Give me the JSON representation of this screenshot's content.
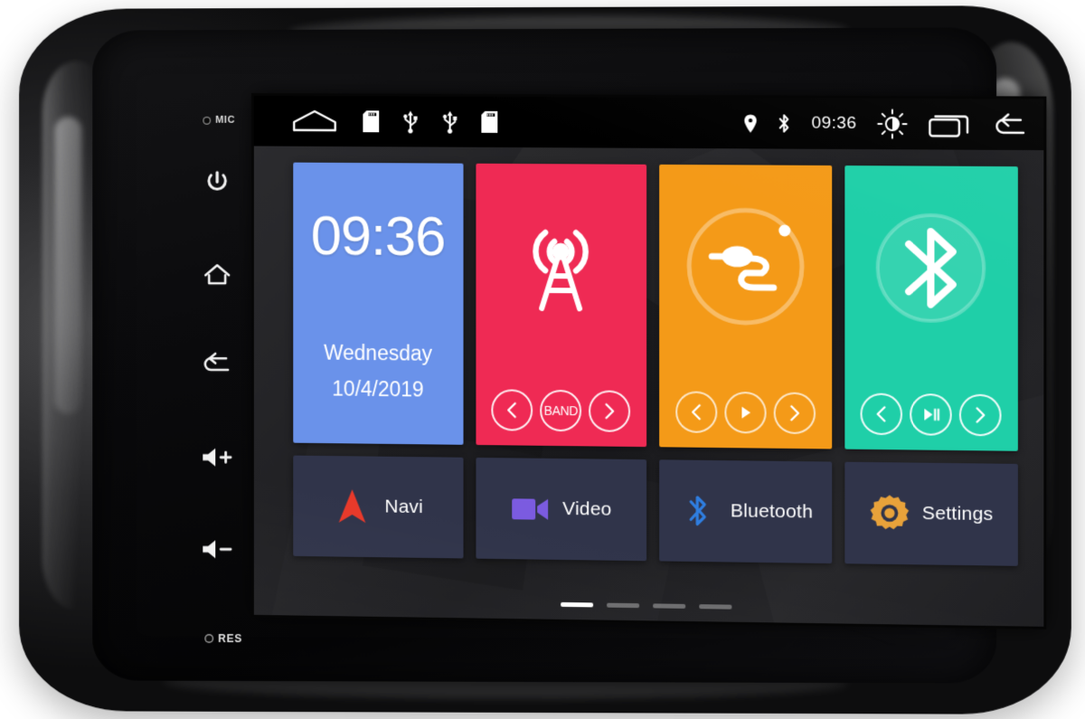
{
  "device": {
    "bezel": {
      "mic_label": "MIC",
      "res_label": "RES",
      "buttons": [
        {
          "name": "power",
          "label": ""
        },
        {
          "name": "home",
          "label": ""
        },
        {
          "name": "back",
          "label": ""
        },
        {
          "name": "volume-up",
          "label": ""
        },
        {
          "name": "volume-down",
          "label": ""
        }
      ]
    }
  },
  "statusbar": {
    "left_icons": [
      "home-icon",
      "sd-card-icon",
      "usb-icon",
      "usb-icon",
      "sd-card-icon"
    ],
    "right_icons": [
      "location-pin-icon",
      "bluetooth-icon",
      "brightness-icon",
      "recents-icon",
      "back-icon"
    ],
    "time": "09:36"
  },
  "tiles": [
    {
      "name": "clock-widget",
      "color": "#6a92ea",
      "time": "09:36",
      "day": "Wednesday",
      "date": "10/4/2019"
    },
    {
      "name": "radio-widget",
      "color": "#ef2a54",
      "art_icon": "radio-tower-icon",
      "controls": [
        {
          "name": "radio-prev-button",
          "icon": "chevron-left-icon",
          "label": ""
        },
        {
          "name": "radio-band-button",
          "icon": "band-text",
          "label": "BAND"
        },
        {
          "name": "radio-next-button",
          "icon": "chevron-right-icon",
          "label": ""
        }
      ]
    },
    {
      "name": "aux-widget",
      "color": "#f49a18",
      "art_icon": "aux-cable-icon",
      "controls": [
        {
          "name": "aux-prev-button",
          "icon": "chevron-left-icon",
          "label": ""
        },
        {
          "name": "aux-play-button",
          "icon": "play-icon",
          "label": ""
        },
        {
          "name": "aux-next-button",
          "icon": "chevron-right-icon",
          "label": ""
        }
      ]
    },
    {
      "name": "bluetooth-widget",
      "color": "#1fcfa8",
      "art_icon": "bluetooth-icon",
      "controls": [
        {
          "name": "bt-prev-button",
          "icon": "chevron-left-icon",
          "label": ""
        },
        {
          "name": "bt-playpause-button",
          "icon": "play-pause-icon",
          "label": ""
        },
        {
          "name": "bt-next-button",
          "icon": "chevron-right-icon",
          "label": ""
        }
      ]
    }
  ],
  "shortcuts": [
    {
      "name": "navi",
      "label": "Navi",
      "icon": "navigation-arrow-icon",
      "color": "#e8392a"
    },
    {
      "name": "video",
      "label": "Video",
      "icon": "video-camera-icon",
      "color": "#7b5be0"
    },
    {
      "name": "bluetooth",
      "label": "Bluetooth",
      "icon": "bluetooth-icon",
      "color": "#2f7ee0"
    },
    {
      "name": "settings",
      "label": "Settings",
      "icon": "gear-icon",
      "color": "#e8a23a"
    }
  ],
  "pager": {
    "count": 4,
    "active_index": 0
  },
  "colors": {
    "tile_clock": "#6a92ea",
    "tile_radio": "#ef2a54",
    "tile_aux": "#f49a18",
    "tile_bluetooth": "#1fcfa8",
    "shortcut_bg": "#30344a",
    "wallpaper": "#232326",
    "statusbar": "#000000"
  }
}
